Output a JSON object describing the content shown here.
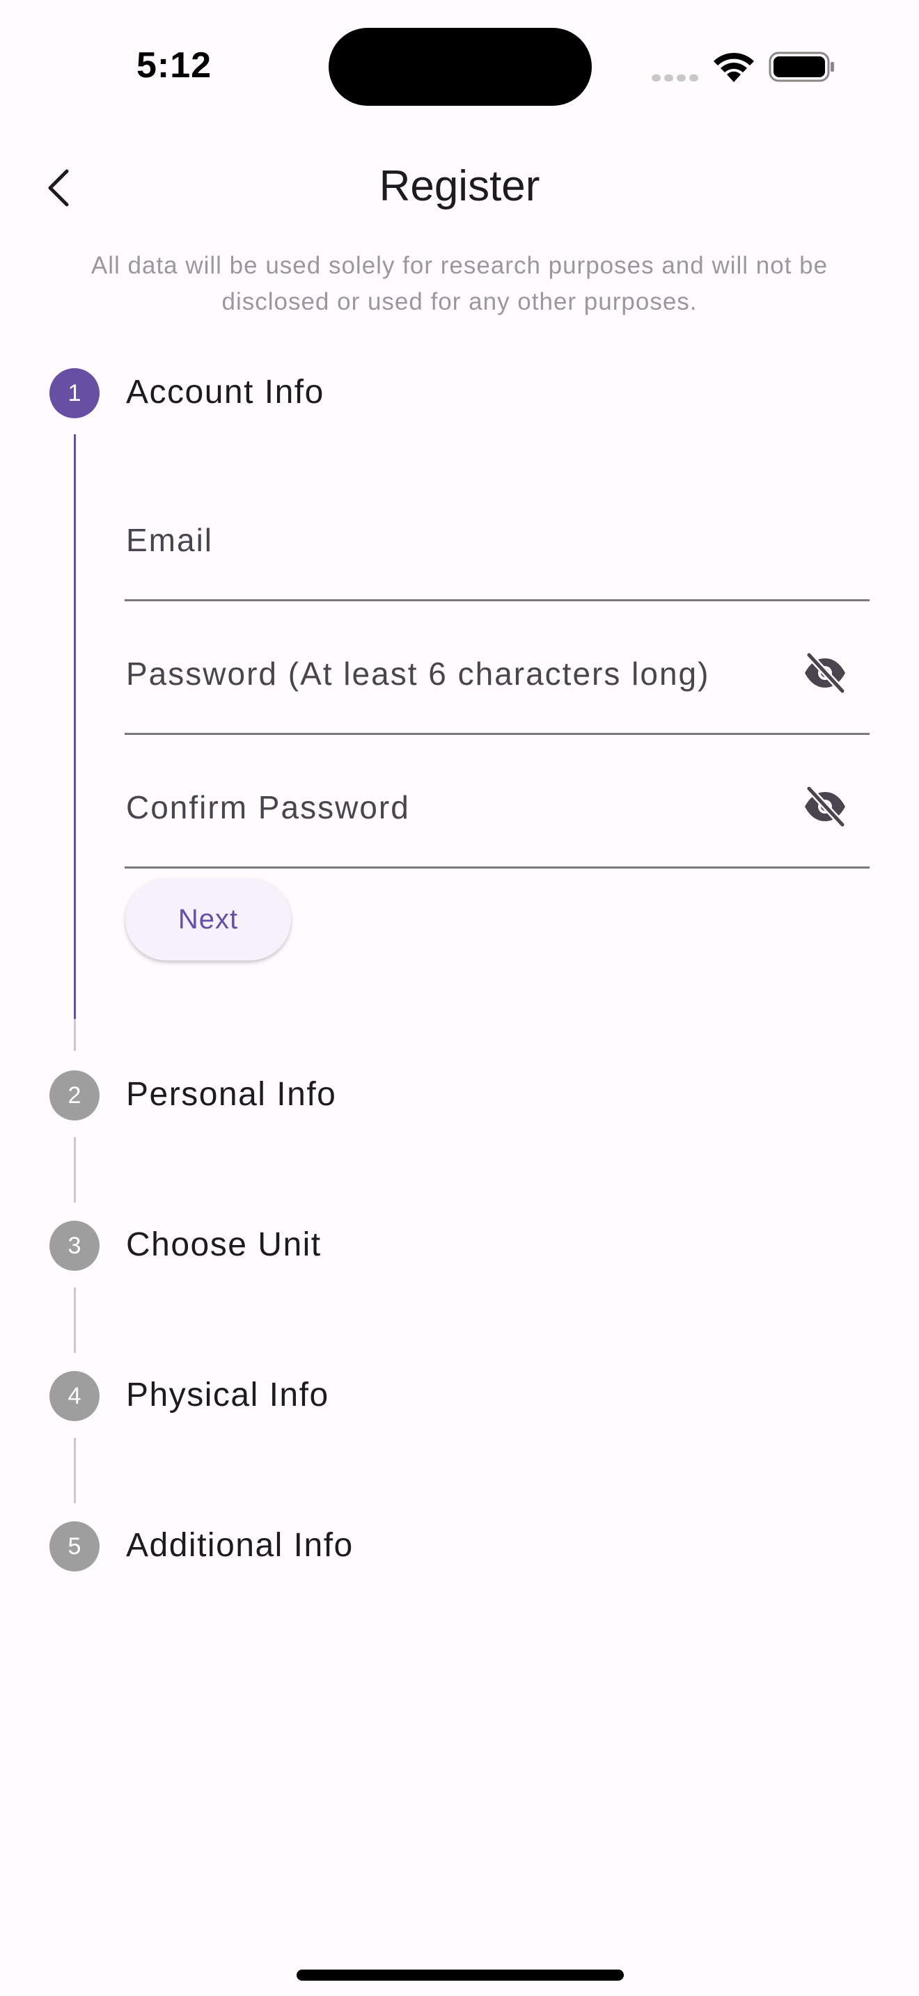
{
  "status_bar": {
    "time": "5:12"
  },
  "header": {
    "title": "Register"
  },
  "disclaimer": "All data will be used solely for research purposes and will not be disclosed or used for any other purposes.",
  "steps": [
    {
      "number": "1",
      "label": "Account Info",
      "state": "active"
    },
    {
      "number": "2",
      "label": "Personal Info",
      "state": "inactive"
    },
    {
      "number": "3",
      "label": "Choose Unit",
      "state": "inactive"
    },
    {
      "number": "4",
      "label": "Physical Info",
      "state": "inactive"
    },
    {
      "number": "5",
      "label": "Additional Info",
      "state": "inactive"
    }
  ],
  "form": {
    "email": {
      "placeholder": "Email",
      "value": ""
    },
    "password": {
      "placeholder": "Password (At least 6 characters long)",
      "value": "",
      "toggle_icon": "eye-off-icon"
    },
    "confirm_password": {
      "placeholder": "Confirm Password",
      "value": "",
      "toggle_icon": "eye-off-icon"
    },
    "next_label": "Next"
  },
  "colors": {
    "primary": "#6750a4",
    "inactive_step": "#9e9e9e",
    "background": "#fffbfe",
    "muted_text": "#9a989e"
  }
}
